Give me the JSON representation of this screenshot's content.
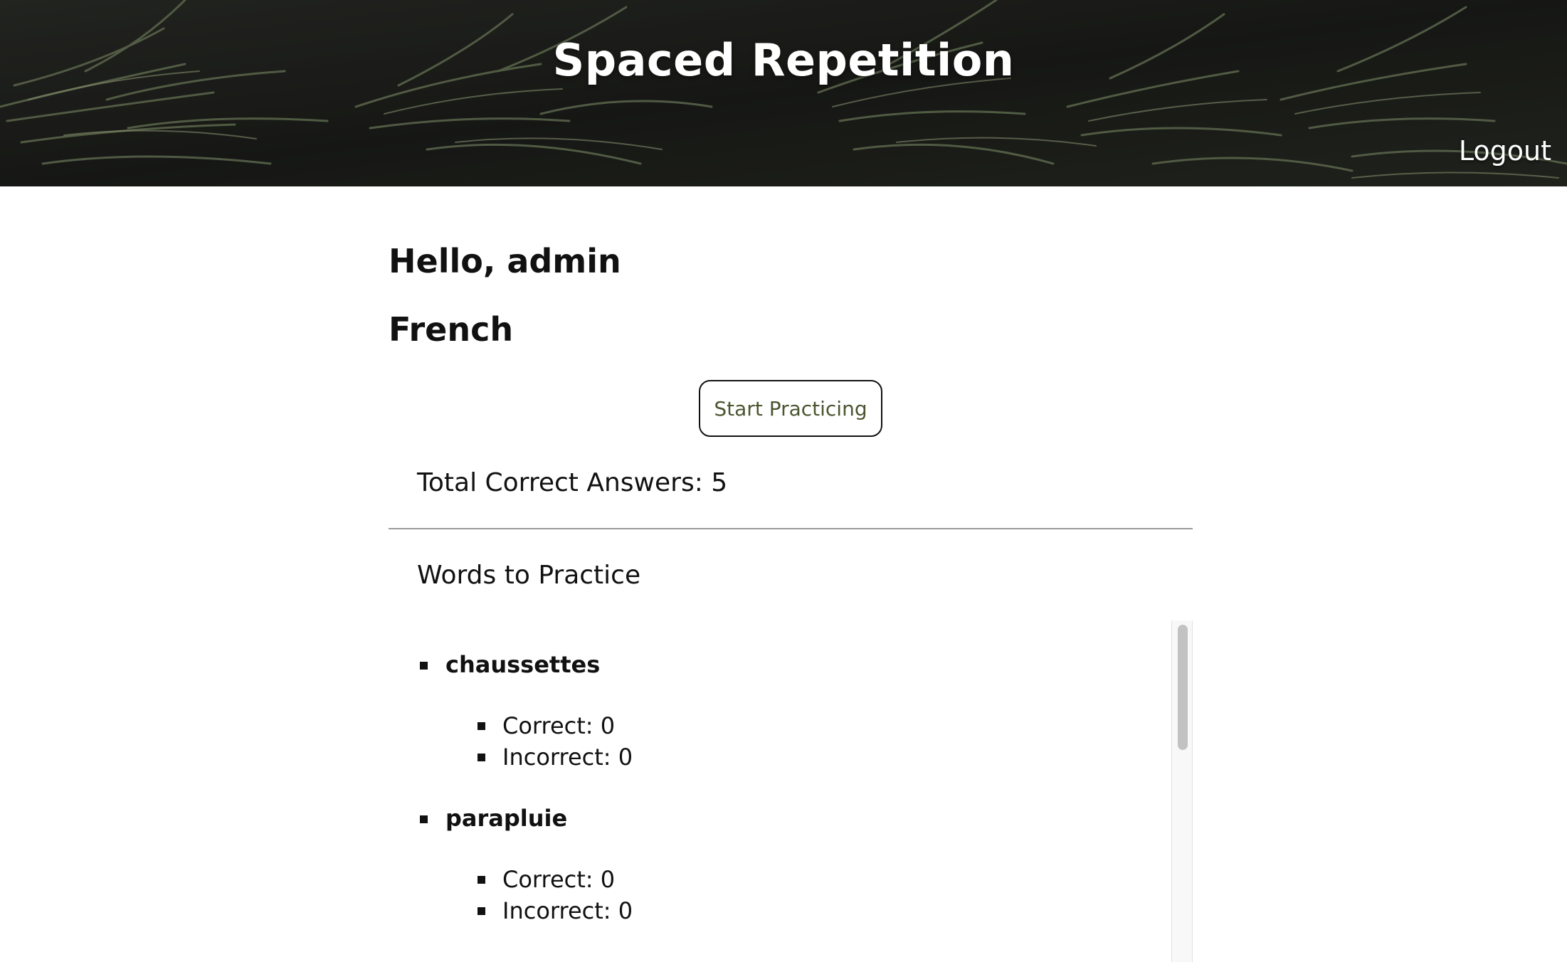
{
  "header": {
    "title": "Spaced Repetition",
    "logout_label": "Logout"
  },
  "main": {
    "greeting": "Hello, admin",
    "language": "French",
    "start_button_label": "Start Practicing",
    "total_correct": "Total Correct Answers: 5",
    "words_heading": "Words to Practice",
    "words": [
      {
        "name": "chaussettes",
        "correct": "Correct: 0",
        "incorrect": "Incorrect: 0"
      },
      {
        "name": "parapluie",
        "correct": "Correct: 0",
        "incorrect": "Incorrect: 0"
      }
    ]
  },
  "colors": {
    "button_text": "#4b5530",
    "divider": "#9a9a9a",
    "header_bg": "#1f201d"
  }
}
